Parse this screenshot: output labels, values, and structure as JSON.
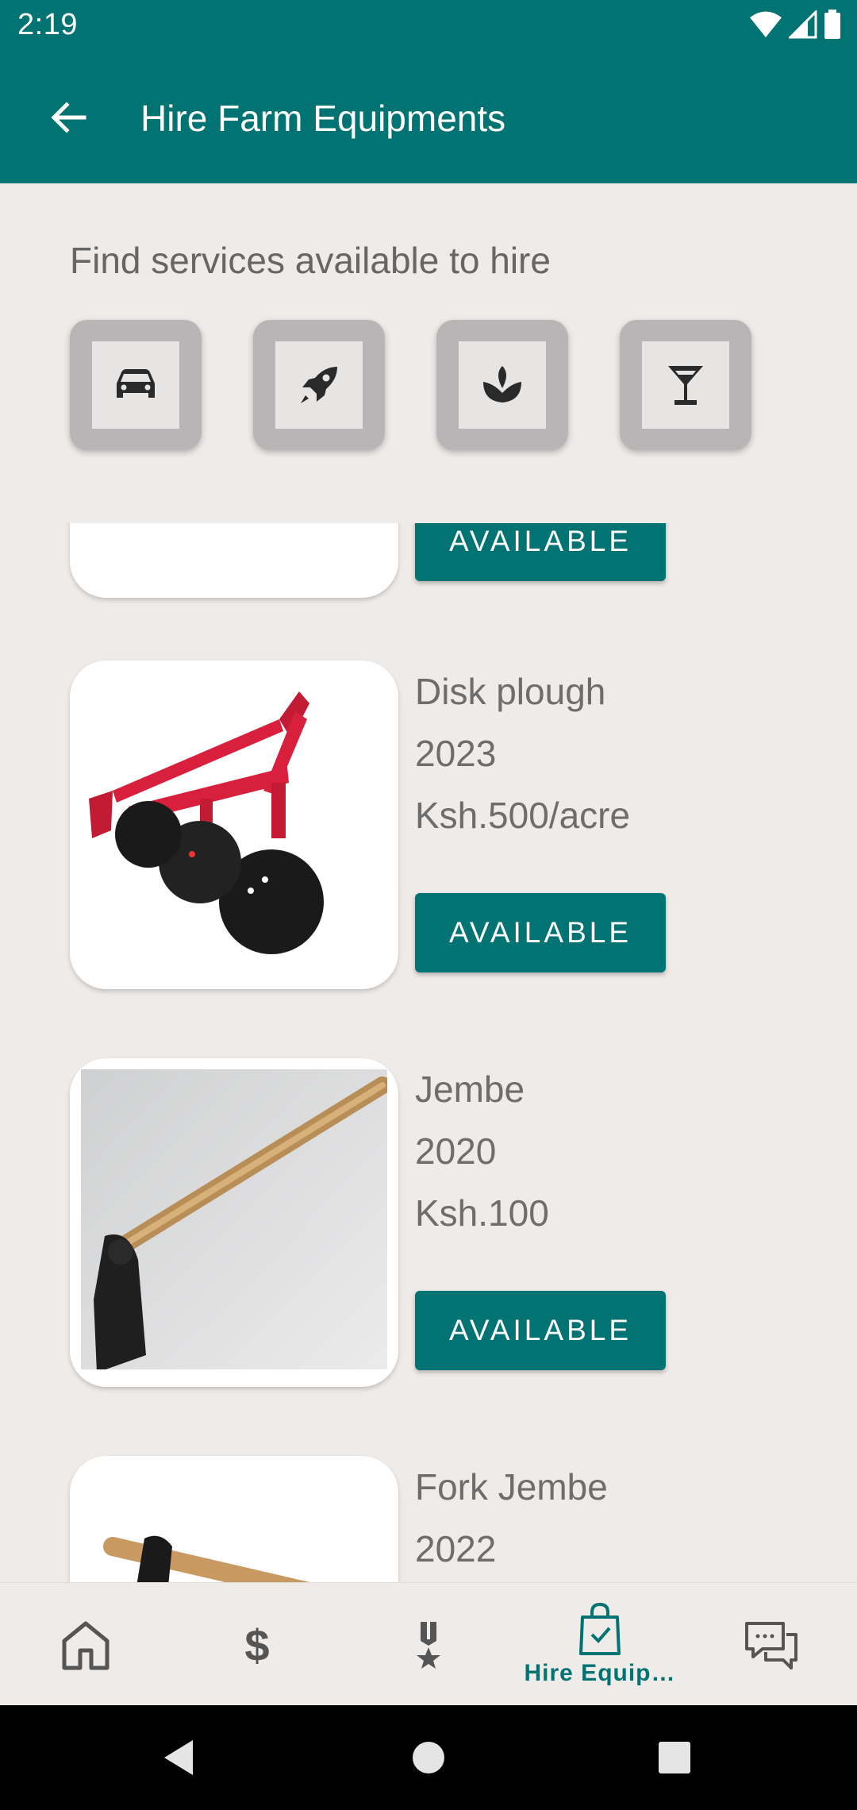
{
  "status_bar": {
    "time": "2:19"
  },
  "app_bar": {
    "title": "Hire Farm Equipments"
  },
  "section": {
    "title": "Find services available to hire"
  },
  "categories": [
    {
      "icon": "car-icon"
    },
    {
      "icon": "rocket-icon"
    },
    {
      "icon": "plant-icon"
    },
    {
      "icon": "cocktail-icon"
    }
  ],
  "items": [
    {
      "name": "",
      "year": "",
      "price": "",
      "status": "AVAILABLE"
    },
    {
      "name": "Disk plough",
      "year": "2023",
      "price": "Ksh.500/acre",
      "status": "AVAILABLE"
    },
    {
      "name": "Jembe",
      "year": "2020",
      "price": "Ksh.100",
      "status": "AVAILABLE"
    },
    {
      "name": "Fork Jembe",
      "year": "2022"
    }
  ],
  "bottom_nav": {
    "items": [
      {
        "icon": "home-icon",
        "label": ""
      },
      {
        "icon": "dollar-icon",
        "label": ""
      },
      {
        "icon": "medal-icon",
        "label": ""
      },
      {
        "icon": "shopping-bag-icon",
        "label": "Hire Equip…"
      },
      {
        "icon": "chat-icon",
        "label": ""
      }
    ]
  },
  "colors": {
    "primary": "#007372",
    "background": "#efebe9",
    "text": "#6d6d6d"
  }
}
